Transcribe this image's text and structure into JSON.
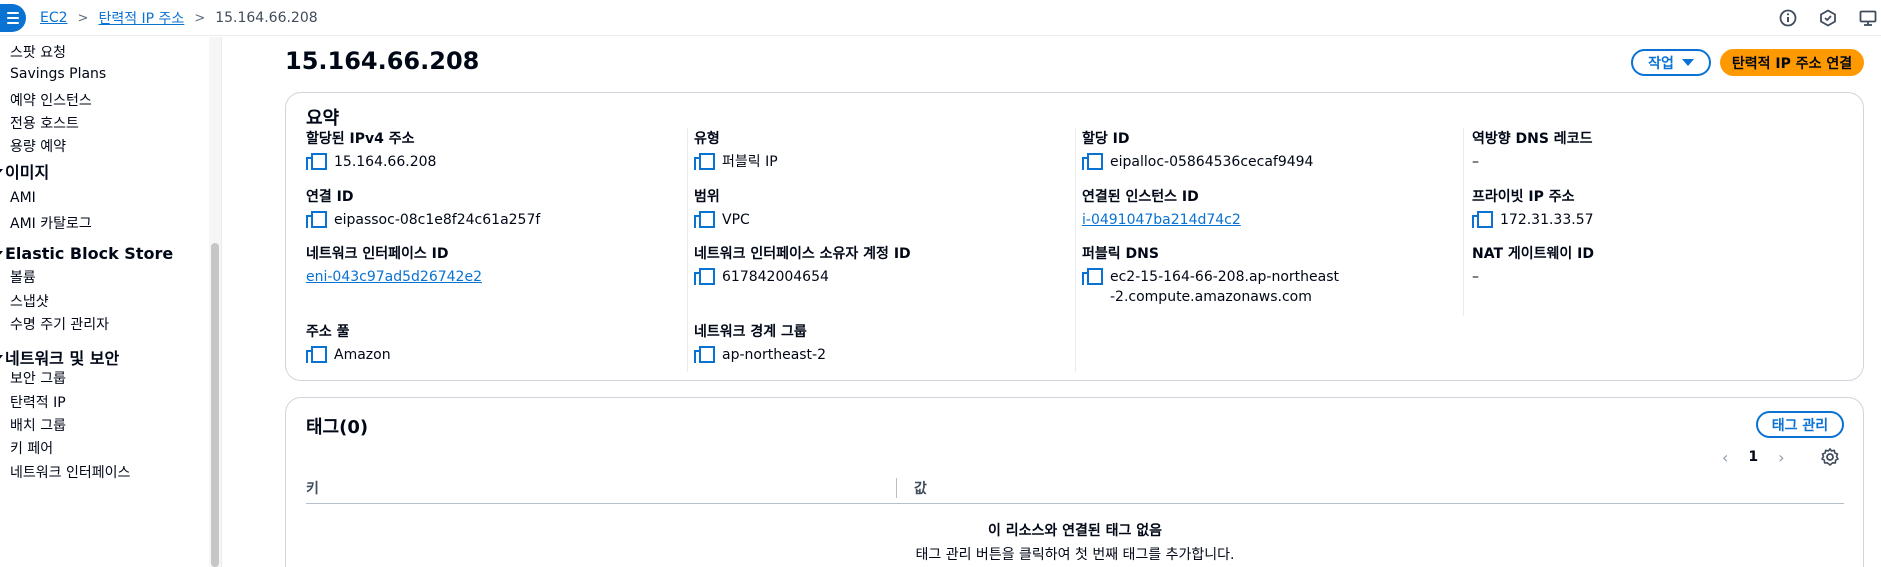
{
  "breadcrumb": {
    "items": [
      "EC2",
      "탄력적 IP 주소"
    ],
    "current": "15.164.66.208"
  },
  "sidebar": {
    "items": [
      {
        "type": "item",
        "label": "스팟 요청"
      },
      {
        "type": "item",
        "label": "Savings Plans"
      },
      {
        "type": "item",
        "label": "예약 인스턴스"
      },
      {
        "type": "item",
        "label": "전용 호스트"
      },
      {
        "type": "item",
        "label": "용량 예약"
      },
      {
        "type": "head",
        "label": "이미지"
      },
      {
        "type": "item",
        "label": "AMI"
      },
      {
        "type": "item",
        "label": "AMI 카탈로그"
      },
      {
        "type": "head",
        "label": "Elastic Block Store"
      },
      {
        "type": "item",
        "label": "볼륨"
      },
      {
        "type": "item",
        "label": "스냅샷"
      },
      {
        "type": "item",
        "label": "수명 주기 관리자"
      },
      {
        "type": "head",
        "label": "네트워크 및 보안"
      },
      {
        "type": "item",
        "label": "보안 그룹"
      },
      {
        "type": "item",
        "label": "탄력적 IP"
      },
      {
        "type": "item",
        "label": "배치 그룹"
      },
      {
        "type": "item",
        "label": "키 페어"
      },
      {
        "type": "item",
        "label": "네트워크 인터페이스"
      }
    ]
  },
  "page": {
    "title": "15.164.66.208",
    "actions_label": "작업",
    "primary_label": "탄력적 IP 주소 연결"
  },
  "summary": {
    "title": "요약",
    "col1": [
      {
        "label": "할당된 IPv4 주소",
        "value": "15.164.66.208",
        "copy": true,
        "link": false
      },
      {
        "label": "연결 ID",
        "value": "eipassoc-08c1e8f24c61a257f",
        "copy": true,
        "link": false
      },
      {
        "label": "네트워크 인터페이스 ID",
        "value": "eni-043c97ad5d26742e2",
        "copy": false,
        "link": true
      },
      {
        "label": "주소 풀",
        "value": "Amazon",
        "copy": true,
        "link": false
      }
    ],
    "col2": [
      {
        "label": "유형",
        "value": "퍼블릭 IP",
        "copy": true,
        "link": false
      },
      {
        "label": "범위",
        "value": "VPC",
        "copy": true,
        "link": false
      },
      {
        "label": "네트워크 인터페이스 소유자 계정 ID",
        "value": "617842004654",
        "copy": true,
        "link": false
      },
      {
        "label": "네트워크 경계 그룹",
        "value": "ap-northeast-2",
        "copy": true,
        "link": false
      }
    ],
    "col3": [
      {
        "label": "할당 ID",
        "value": "eipalloc-05864536cecaf9494",
        "copy": true,
        "link": false
      },
      {
        "label": "연결된 인스턴스 ID",
        "value": "i-0491047ba214d74c2",
        "copy": false,
        "link": true
      },
      {
        "label": "퍼블릭 DNS",
        "value": "ec2-15-164-66-208.ap-northeast-2.compute.amazonaws.com",
        "copy": true,
        "link": false
      }
    ],
    "col4": [
      {
        "label": "역방향 DNS 레코드",
        "value": "–",
        "copy": false,
        "link": false
      },
      {
        "label": "프라이빗 IP 주소",
        "value": "172.31.33.57",
        "copy": true,
        "link": false
      },
      {
        "label": "NAT 게이트웨이 ID",
        "value": "–",
        "copy": false,
        "link": false
      }
    ]
  },
  "tags": {
    "title": "태그(0)",
    "manage_label": "태그 관리",
    "page_number": "1",
    "columns": [
      "키",
      "값"
    ],
    "empty_title": "이 리소스와 연결된 태그 없음",
    "empty_sub": "태그 관리 버튼을 클릭하여 첫 번째 태그를 추가합니다."
  }
}
